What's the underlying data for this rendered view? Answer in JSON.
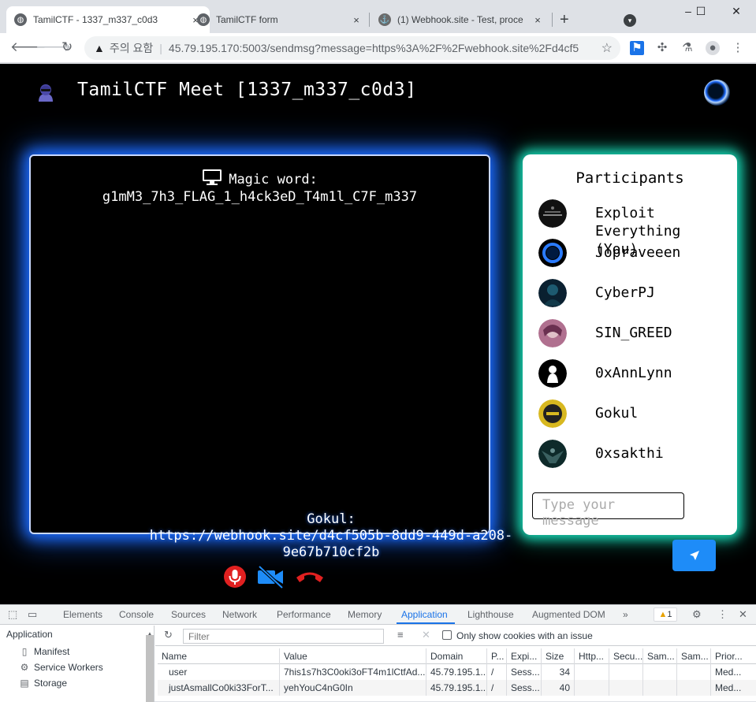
{
  "browser": {
    "tabs": [
      {
        "title": "TamilCTF - 1337_m337_c0d3",
        "active": true
      },
      {
        "title": "TamilCTF form",
        "active": false
      },
      {
        "title": "(1) Webhook.site - Test, proce",
        "active": false
      }
    ],
    "close_glyph": "×",
    "new_tab_glyph": "+",
    "window_controls": [
      "–",
      "☐",
      "✕"
    ],
    "security_label": "주의 요함",
    "url": "45.79.195.170:5003/sendmsg?message=https%3A%2F%2Fwebhook.site%2Fd4cf5..."
  },
  "page": {
    "title": "TamilCTF Meet [1337_m337_c0d3]",
    "video": {
      "magic_label": "Magic word:",
      "magic_word": "g1mM3_7h3_FLAG_1_h4ck3eD_T4m1l_C7F_m337",
      "chat_sender": "Gokul:",
      "chat_message": "https://webhook.site/d4cf505b-8dd9-449d-a208-9e67b710cf2b"
    },
    "participants_title": "Participants",
    "participants": [
      {
        "name": "Exploit Everything (You)",
        "avatar": "exploit-everything-avatar"
      },
      {
        "name": "Jopraveeen",
        "avatar": "blue-ring-avatar"
      },
      {
        "name": "CyberPJ",
        "avatar": "cyber-avatar"
      },
      {
        "name": "SIN_GREED",
        "avatar": "anime-avatar"
      },
      {
        "name": "0xAnnLynn",
        "avatar": "silhouette-avatar"
      },
      {
        "name": "Gokul",
        "avatar": "hacker-avatar"
      },
      {
        "name": "0xsakthi",
        "avatar": "raven-avatar"
      }
    ],
    "message_placeholder": "Type your message"
  },
  "devtools": {
    "tabs": [
      "Elements",
      "Console",
      "Sources",
      "Network",
      "Performance",
      "Memory",
      "Application",
      "Lighthouse",
      "Augmented DOM"
    ],
    "active_tab": "Application",
    "more_glyph": "»",
    "warning_count": "1",
    "sidebar": {
      "header": "Application",
      "items": [
        "Manifest",
        "Service Workers",
        "Storage"
      ]
    },
    "filter_placeholder": "Filter",
    "only_issues_label": "Only show cookies with an issue",
    "columns": [
      "Name",
      "Value",
      "Domain",
      "P...",
      "Expi...",
      "Size",
      "Http...",
      "Secu...",
      "Sam...",
      "Sam...",
      "Prior..."
    ],
    "cookies": [
      [
        "user",
        "7his1s7h3C0oki3oFT4m1lCtfAd...",
        "45.79.195.1...",
        "/",
        "Sess...",
        "34",
        "",
        "",
        "",
        "",
        "Med..."
      ],
      [
        "justAsmallCo0ki33ForT...",
        "yehYouC4nG0In",
        "45.79.195.1...",
        "/",
        "Sess...",
        "40",
        "",
        "",
        "",
        "",
        "Med..."
      ]
    ]
  },
  "colors": {
    "video_glow": "#1d6cff",
    "panel_glow": "#18d4b2",
    "send_button": "#1e8cf8",
    "mic_red": "#e02020",
    "cam_blue": "#1e8cf8",
    "devtools_accent": "#1a73e8"
  }
}
